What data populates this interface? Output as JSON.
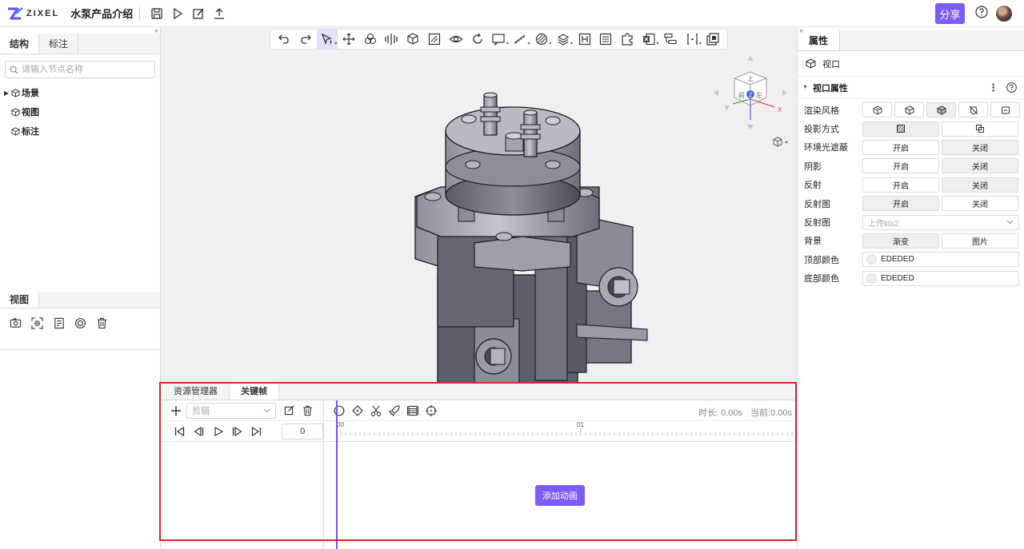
{
  "app": {
    "logo_text": "ZIXEL",
    "project_title": "水泵产品介绍",
    "share_label": "分享",
    "accent_color": "#7c5cf5",
    "header_icons": [
      "save-icon",
      "play-icon",
      "edit-icon",
      "upload-icon"
    ]
  },
  "left_panel": {
    "tabs": [
      {
        "label": "结构",
        "active": true
      },
      {
        "label": "标注",
        "active": false
      }
    ],
    "search_placeholder": "请输入节点名称",
    "tree": [
      {
        "label": "场景",
        "expandable": true
      },
      {
        "label": "视图",
        "expandable": false
      },
      {
        "label": "标注",
        "expandable": false
      }
    ],
    "view_tab": "视图",
    "view_tools": [
      "camera-icon",
      "focus-icon",
      "view-list-icon",
      "target-icon",
      "trash-icon"
    ]
  },
  "viewport": {
    "toolbar": [
      "undo-icon",
      "redo-icon",
      "select-icon",
      "move-icon",
      "cluster-icon",
      "explode-icon",
      "cube-icon",
      "section-icon",
      "eye-icon",
      "rotate-icon",
      "comment-icon",
      "measure-icon",
      "material-icon",
      "layers-icon",
      "split-icon",
      "list-icon",
      "puzzle-icon",
      "excel-icon",
      "tree-icon",
      "bracket-icon",
      "window-icon"
    ],
    "nav_cube_faces": {
      "top": "上",
      "front": "前",
      "right": "左"
    },
    "axes": {
      "x": "X",
      "y": "Y",
      "z": "Z"
    }
  },
  "dock": {
    "tabs": [
      {
        "label": "资源管理器",
        "active": false
      },
      {
        "label": "关键帧",
        "active": true
      }
    ],
    "clip_placeholder": "剪辑",
    "frame_value": "0",
    "duration_label": "时长: 0.00s",
    "current_label": "当前:0.00s",
    "ruler_labels": [
      "00",
      "01"
    ],
    "add_animation_label": "添加动画",
    "keyframe_tools": [
      "circle-icon",
      "diamond-icon",
      "scissors-icon",
      "rocket-icon",
      "film-icon",
      "crosshair-icon"
    ]
  },
  "right_panel": {
    "tab": "属性",
    "node_label": "视口",
    "section_title": "视口属性",
    "rows": {
      "render_style": {
        "label": "渲染风格"
      },
      "projection": {
        "label": "投影方式"
      },
      "ambient_occlusion": {
        "label": "环境光遮蔽",
        "on": "开启",
        "off": "关闭"
      },
      "shadow": {
        "label": "阴影",
        "on": "开启",
        "off": "关闭"
      },
      "reflection": {
        "label": "反射",
        "on": "开启",
        "off": "关闭"
      },
      "reflection_map": {
        "label": "反射图",
        "on": "开启",
        "off": "关闭"
      },
      "reflection_map_upload": {
        "label": "反射图",
        "placeholder": "上传ktx2"
      },
      "background": {
        "label": "背景",
        "gradient": "渐变",
        "image": "图片"
      },
      "top_color": {
        "label": "顶部颜色",
        "value": "EDEDED"
      },
      "bottom_color": {
        "label": "底部颜色",
        "value": "EDEDED"
      }
    }
  }
}
